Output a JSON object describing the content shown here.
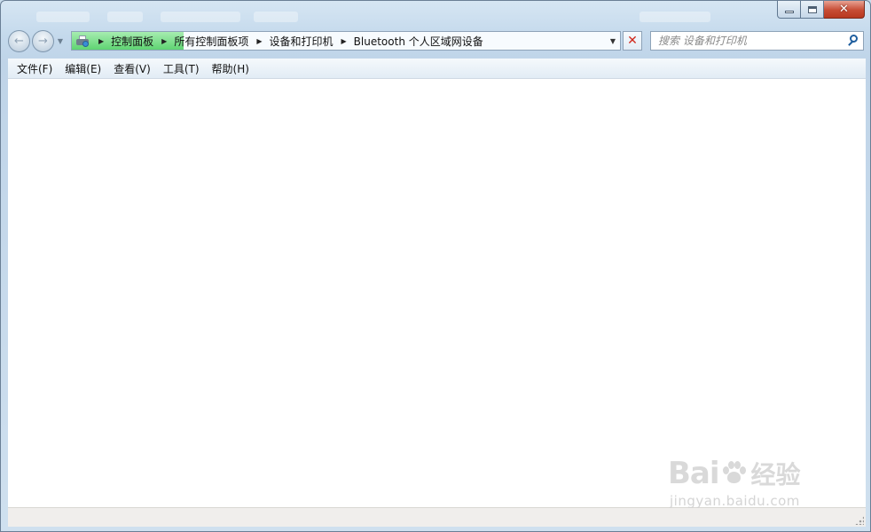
{
  "address_bar": {
    "breadcrumbs": [
      "控制面板",
      "所有控制面板项",
      "设备和打印机",
      "Bluetooth 个人区域网设备"
    ],
    "load_progress_percent": 20
  },
  "search": {
    "placeholder": "搜索 设备和打印机"
  },
  "menu": {
    "items": [
      "文件(F)",
      "编辑(E)",
      "查看(V)",
      "工具(T)",
      "帮助(H)"
    ]
  },
  "watermark": {
    "logo_text": "Baidu经验",
    "url": "jingyan.baidu.com"
  },
  "colors": {
    "stop_icon": "#d0281b",
    "progress": "#5fd472",
    "close_button": "#c74c34"
  }
}
